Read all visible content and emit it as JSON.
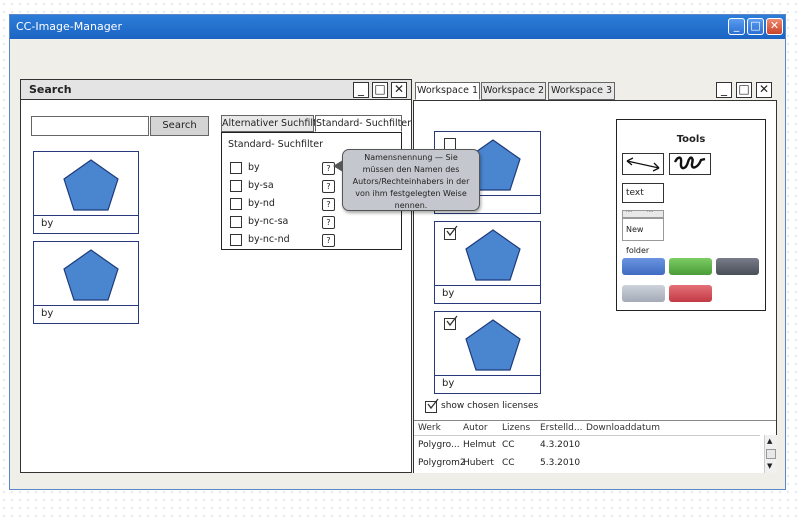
{
  "window": {
    "title": "CC-Image-Manager"
  },
  "search_panel": {
    "title": "Search",
    "button": "Search",
    "input_value": "",
    "thumbnails": [
      {
        "caption": "by"
      },
      {
        "caption": "by"
      }
    ]
  },
  "filter": {
    "tabs": [
      "Alternativer Suchfilter",
      "Standard- Suchfilter"
    ],
    "heading": "Standard- Suchfilter",
    "items": [
      "by",
      "by-sa",
      "by-nd",
      "by-nc-sa",
      "by-nc-nd"
    ],
    "help_label": "?"
  },
  "tooltip": {
    "text": "Namensnennung — Sie müssen den Namen des Autors/Rechteinhabers in der von ihm festgelegten Weise nennen."
  },
  "workspace": {
    "tabs": [
      "Workspace 1",
      "Workspace 2",
      "Workspace 3"
    ],
    "thumbnails": [
      {
        "caption": "",
        "checked": false
      },
      {
        "caption": "by",
        "checked": true
      },
      {
        "caption": "by",
        "checked": true
      }
    ],
    "show_chosen_label": "show chosen licenses",
    "show_chosen_checked": true
  },
  "tools": {
    "title": "Tools",
    "text_button": "text",
    "new_folder_label": "New folder",
    "folder_tabs": [
      "····",
      "····"
    ],
    "swatches": [
      "#4a78cc",
      "#5fb04a",
      "#5a5f6a",
      "#b4bac6",
      "#d34a52"
    ]
  },
  "table": {
    "columns": [
      "Werk",
      "Autor",
      "Lizens",
      "Erstelld...",
      "Downloaddatum"
    ],
    "rows": [
      [
        "Polygro...",
        "Helmut",
        "CC",
        "4.3.2010",
        ""
      ],
      [
        "Polygrom2",
        "Hubert",
        "CC",
        "5.3.2010",
        ""
      ]
    ]
  },
  "colors": {
    "accent": "#1c64c4",
    "pentagon": "#4a86d0",
    "thumb_border": "#27397a"
  }
}
